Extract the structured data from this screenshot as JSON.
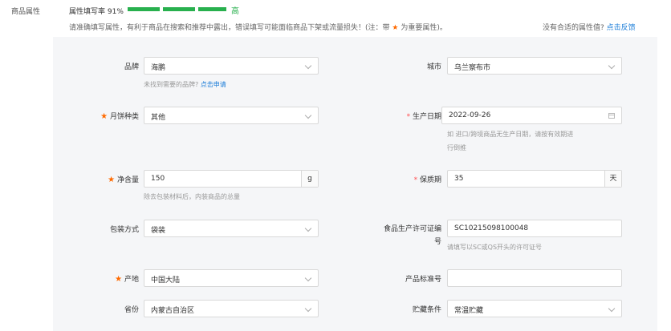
{
  "section": {
    "label": "商品属性"
  },
  "fill_rate": {
    "label": "属性填写率 91%",
    "level": "高",
    "percent": 91,
    "color": "#28b04e"
  },
  "notice": {
    "prefix": "请准确填写属性，有利于商品在搜索和推荐中露出，错误填写可能面临商品下架或流量损失！(注：带",
    "suffix": "为重要属性)。"
  },
  "no_attr": {
    "text": "没有合适的属性值?",
    "link": "点击反馈"
  },
  "fields": {
    "brand": {
      "label": "品牌",
      "value": "海鹏",
      "hint": "未找到需要的品牌?",
      "hint_link": "点击申请"
    },
    "city": {
      "label": "城市",
      "value": "乌兰察布市"
    },
    "mooncake_type": {
      "label": "月饼种类",
      "value": "其他"
    },
    "prod_date": {
      "label": "生产日期",
      "value": "2022-09-26",
      "hint_line1": "如 进口/跨境商品无生产日期，请按有效期进",
      "hint_line2": "行倒推"
    },
    "net_weight": {
      "label": "净含量",
      "value": "150",
      "unit": "g",
      "hint": "除去包装材料后，内装商品的总量"
    },
    "shelf_life": {
      "label": "保质期",
      "value": "35",
      "unit": "天"
    },
    "packaging": {
      "label": "包装方式",
      "value": "袋装"
    },
    "license": {
      "label_line1": "食品生产许可证编",
      "label_line2": "号",
      "value": "SC10215098100048",
      "hint": "请填写以SC或QS开头的许可证号"
    },
    "origin": {
      "label": "产地",
      "value": "中国大陆"
    },
    "standard": {
      "label": "产品标准号",
      "value": ""
    },
    "province": {
      "label": "省份",
      "value": "内蒙古自治区"
    },
    "storage": {
      "label": "贮藏条件",
      "value": "常温贮藏"
    }
  },
  "colors": {
    "accent": "#28b04e",
    "required_star": "#ff6a00",
    "link": "#1a7cd8"
  },
  "icons": {
    "dropdown": "chevron-down-icon",
    "date": "calendar-icon",
    "required": "star-icon"
  }
}
